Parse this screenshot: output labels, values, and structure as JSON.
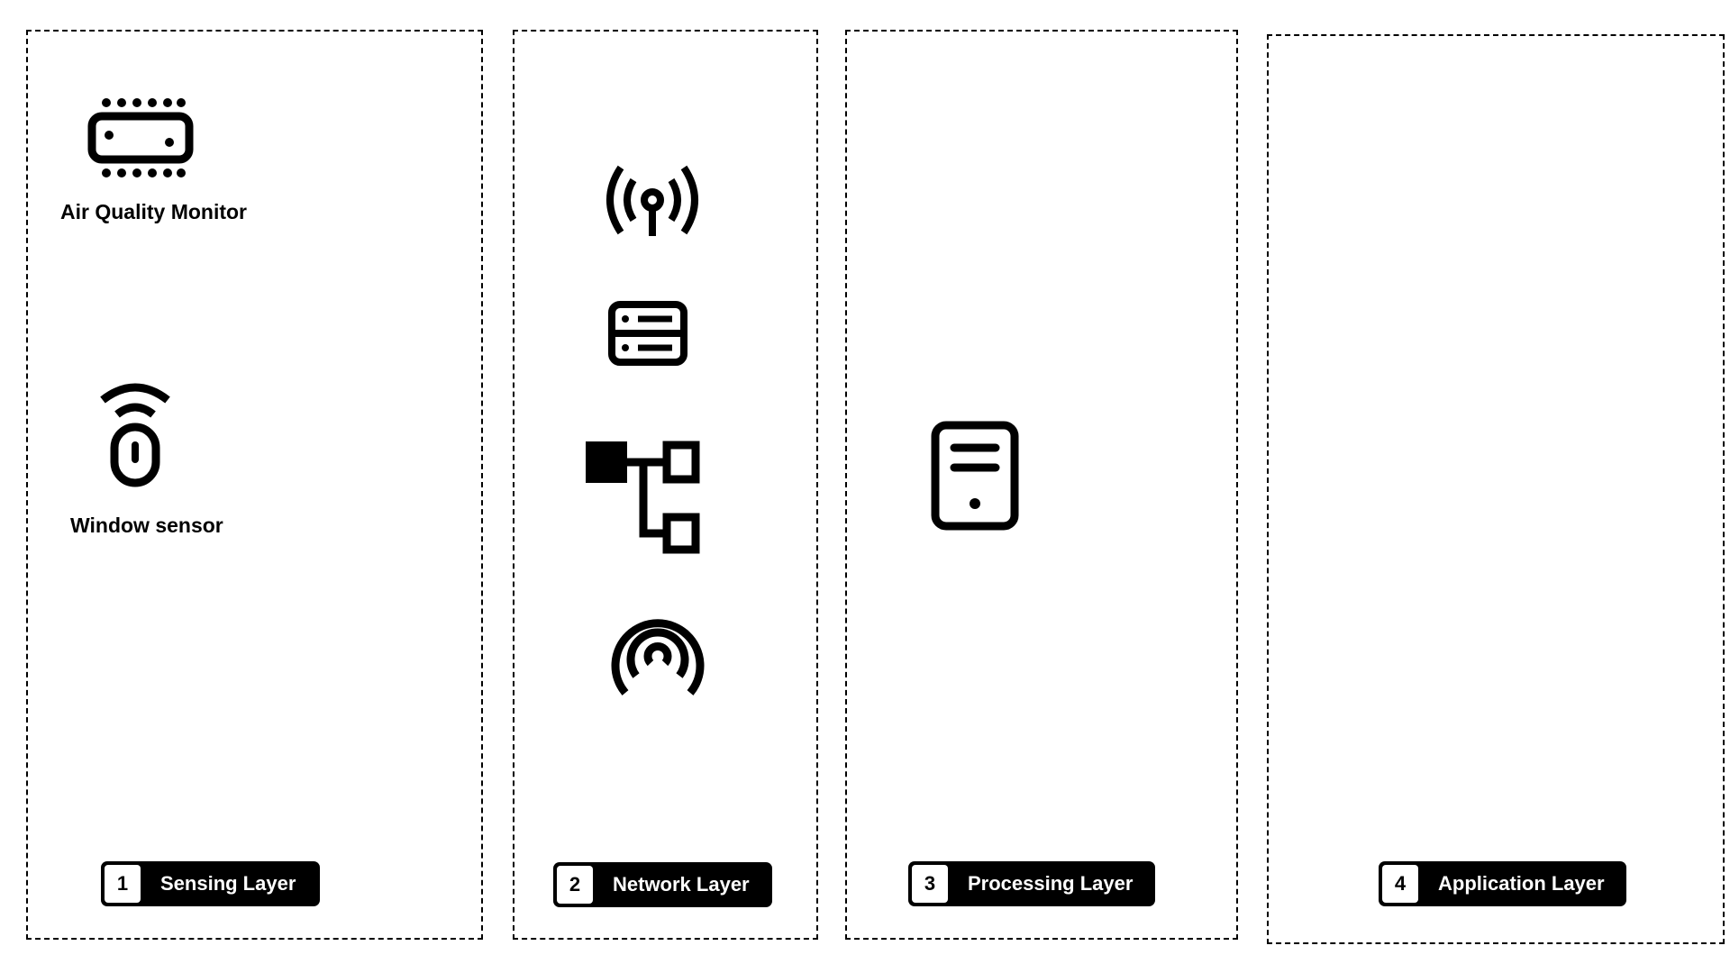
{
  "layers": [
    {
      "number": "1",
      "title": "Sensing Layer"
    },
    {
      "number": "2",
      "title": "Network Layer"
    },
    {
      "number": "3",
      "title": "Processing Layer"
    },
    {
      "number": "4",
      "title": "Application Layer"
    }
  ],
  "devices": {
    "air_quality_monitor": {
      "label": "Air Quality Monitor",
      "icon": "air-quality-monitor-icon"
    },
    "window_sensor": {
      "label": "Window sensor",
      "icon": "window-sensor-icon"
    }
  },
  "network_icons": [
    "radio-tower-icon",
    "server-rack-icon",
    "network-hierarchy-icon",
    "airdrop-signal-icon"
  ],
  "processing_icons": [
    "server-tower-icon"
  ],
  "colors": {
    "stroke": "#000000",
    "background": "#ffffff"
  }
}
